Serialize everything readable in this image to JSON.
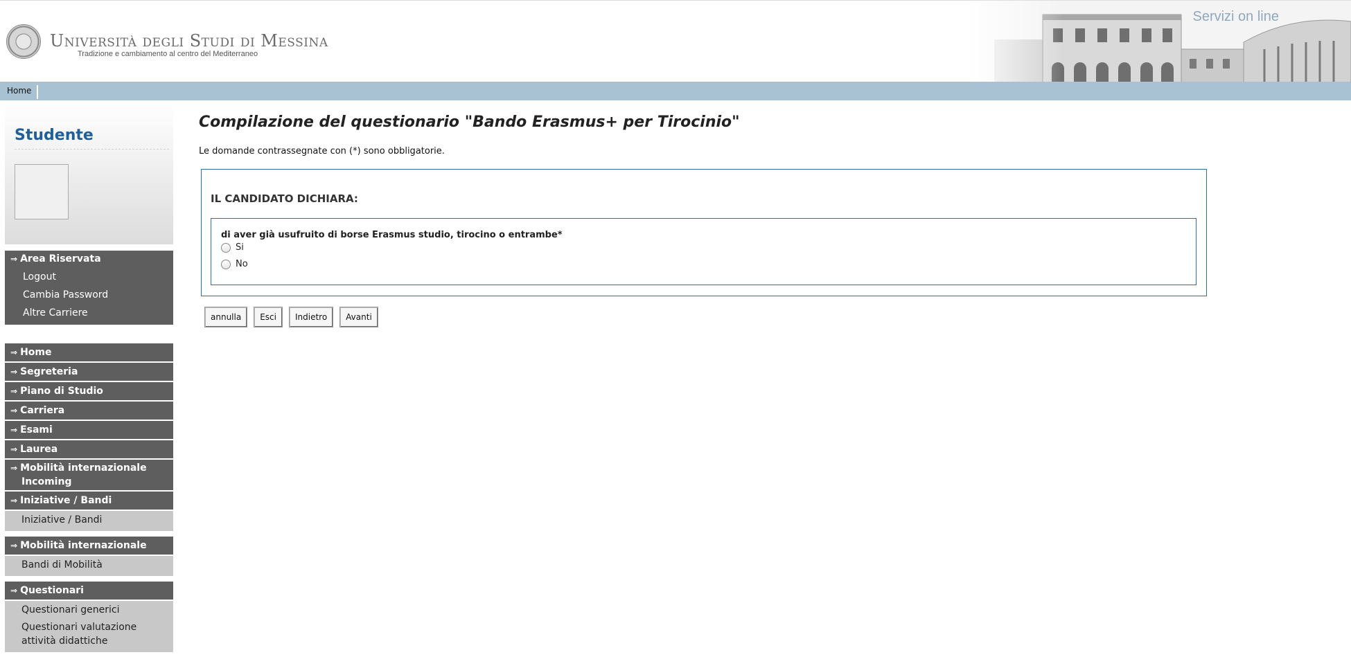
{
  "header": {
    "university_name": "Università degli Studi di Messina",
    "tagline": "Tradizione e cambiamento al centro del Mediterraneo",
    "service_label": "Servizi on line",
    "logo_icon": "university-seal-icon"
  },
  "navbar": {
    "home": "Home"
  },
  "sidebar": {
    "title": "Studente",
    "area": {
      "heading": "Area Riservata",
      "items": [
        "Logout",
        "Cambia Password",
        "Altre Carriere"
      ]
    },
    "menu": [
      {
        "label": "Home"
      },
      {
        "label": "Segreteria"
      },
      {
        "label": "Piano di Studio"
      },
      {
        "label": "Carriera"
      },
      {
        "label": "Esami"
      },
      {
        "label": "Laurea"
      },
      {
        "label": "Mobilità internazionale Incoming"
      },
      {
        "label": "Iniziative / Bandi",
        "sub": [
          "Iniziative / Bandi"
        ]
      },
      {
        "label": "Mobilità internazionale",
        "sub": [
          "Bandi di Mobilità"
        ]
      },
      {
        "label": "Questionari",
        "sub": [
          "Questionari generici",
          "Questionari valutazione attività didattiche"
        ]
      }
    ],
    "arrow_glyph": "⇒"
  },
  "main": {
    "title": "Compilazione del questionario \"Bando Erasmus+ per Tirocinio\"",
    "mandatory_note": "Le domande contrassegnate con (*) sono obbligatorie.",
    "section_title": "IL CANDIDATO DICHIARA:",
    "question": "di aver già usufruito di borse Erasmus studio, tirocino o entrambe*",
    "options": [
      "Si",
      "No"
    ],
    "buttons": {
      "cancel": "annulla",
      "exit": "Esci",
      "back": "Indietro",
      "next": "Avanti"
    }
  },
  "colors": {
    "accent_blue": "#2a6fb0",
    "navbar": "#a9c2d3",
    "menu_dark": "#5e5e5e",
    "menu_sub": "#c8c8c8"
  }
}
